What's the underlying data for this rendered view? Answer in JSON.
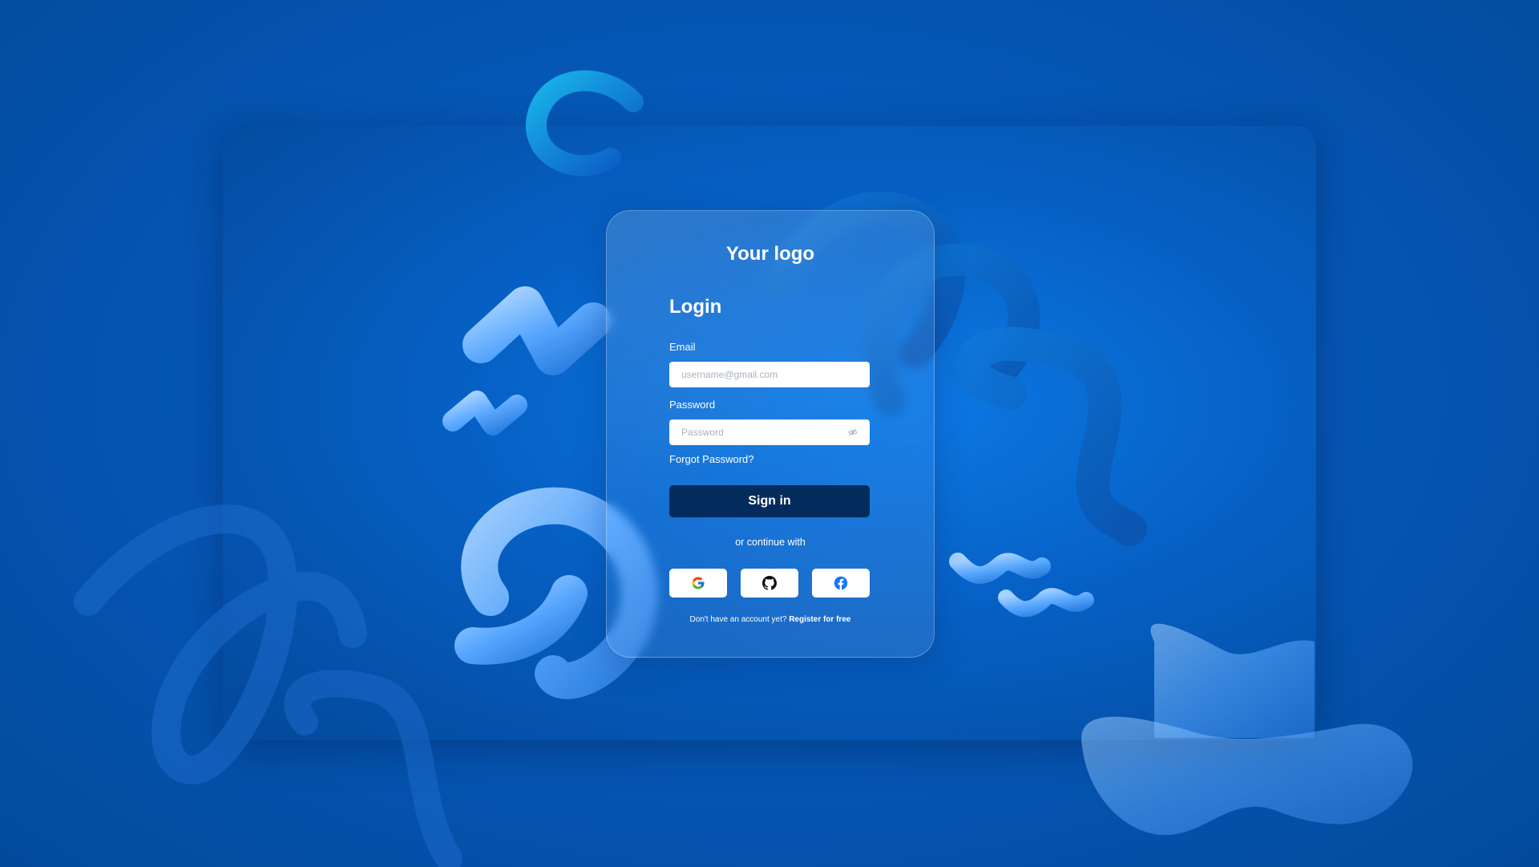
{
  "brand": {
    "logo_text": "Your logo"
  },
  "login": {
    "title": "Login",
    "email_label": "Email",
    "email_placeholder": "username@gmail.com",
    "email_value": "",
    "password_label": "Password",
    "password_placeholder": "Password",
    "password_value": "",
    "forgot_password": "Forgot Password?",
    "sign_in_label": "Sign in",
    "continue_with": "or continue with",
    "social_buttons": [
      {
        "icon": "google-icon"
      },
      {
        "icon": "github-icon"
      },
      {
        "icon": "facebook-icon"
      }
    ],
    "no_account_text": "Don't have an account yet?",
    "register_link": "Register for free"
  },
  "colors": {
    "background": "#0558b8",
    "sign_in_button": "#032b5b",
    "field_background": "#ffffff",
    "text": "#ffffff",
    "shapes": "#5aa8ff"
  }
}
